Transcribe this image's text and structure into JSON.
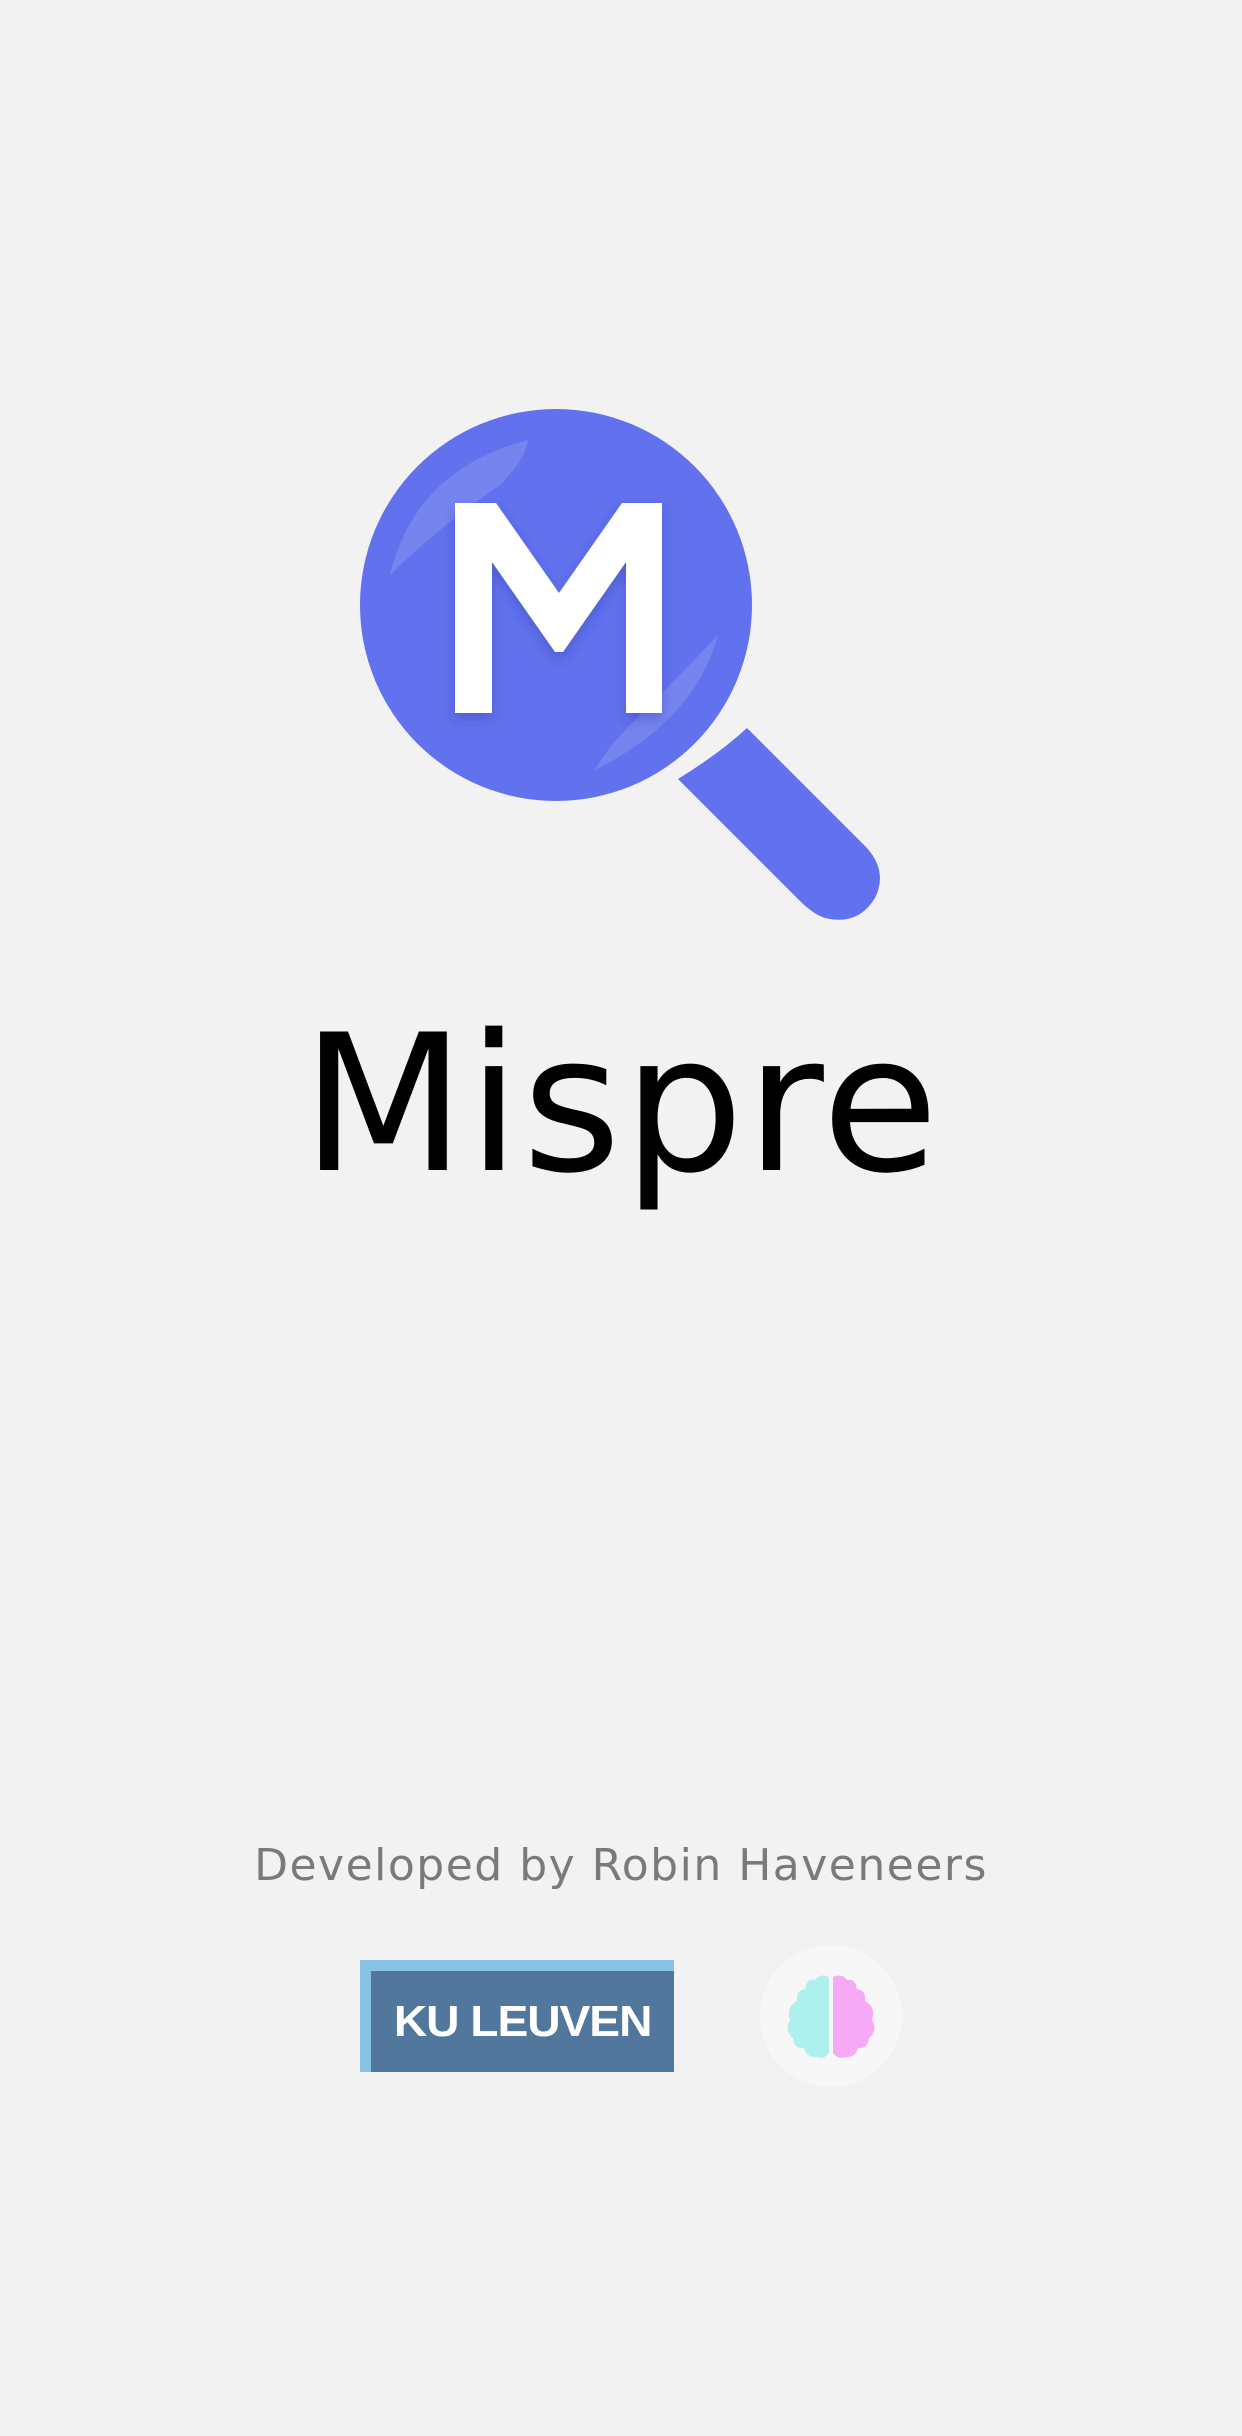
{
  "app": {
    "title": "Mispre",
    "logo_letter": "M",
    "logo_icon": "magnifier-icon",
    "accent_color": "#6272ee"
  },
  "footer": {
    "credit": "Developed by Robin Haveneers",
    "partner_logo_text": "KU LEUVEN",
    "partner_icon": "brain-icon",
    "ku_leuven_color": "#52779d",
    "brain_left_color": "#aef0ee",
    "brain_right_color": "#f6a9f4"
  }
}
